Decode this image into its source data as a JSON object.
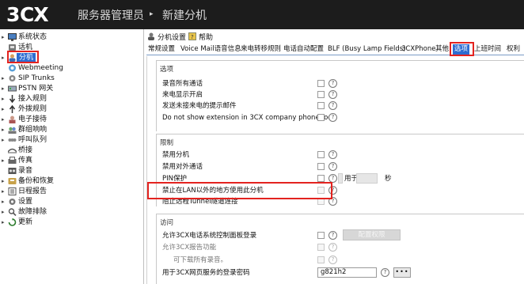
{
  "header": {
    "logo_text": "3CX",
    "title": "服务器管理员",
    "arrow": "▸",
    "page": "新建分机"
  },
  "sidebar": {
    "items": [
      {
        "label": "系统状态",
        "icon": "monitor-icon",
        "expandable": true
      },
      {
        "label": "话机",
        "icon": "phone-icon",
        "expandable": false
      },
      {
        "label": "分机",
        "icon": "user-icon",
        "expandable": true,
        "selected": true
      },
      {
        "label": "Webmeeting",
        "icon": "webmeeting-icon",
        "expandable": false
      },
      {
        "label": "SIP Trunks",
        "icon": "gear-icon",
        "expandable": true
      },
      {
        "label": "PSTN 网关",
        "icon": "gateway-icon",
        "expandable": true
      },
      {
        "label": "接入规则",
        "icon": "inbound-arrow-icon",
        "expandable": true
      },
      {
        "label": "外拨规则",
        "icon": "outbound-arrow-icon",
        "expandable": true
      },
      {
        "label": "电子接待",
        "icon": "receptionist-icon",
        "expandable": true
      },
      {
        "label": "群组响响",
        "icon": "ring-group-icon",
        "expandable": true
      },
      {
        "label": "呼叫队列",
        "icon": "queue-icon",
        "expandable": true
      },
      {
        "label": "桥接",
        "icon": "bridge-icon",
        "expandable": false
      },
      {
        "label": "传真",
        "icon": "fax-icon",
        "expandable": true
      },
      {
        "label": "录音",
        "icon": "recording-icon",
        "expandable": false
      },
      {
        "label": "备份和恢复",
        "icon": "backup-icon",
        "expandable": true
      },
      {
        "label": "日程报告",
        "icon": "report-icon",
        "expandable": true
      },
      {
        "label": "设置",
        "icon": "settings-icon",
        "expandable": true
      },
      {
        "label": "故障排除",
        "icon": "troubleshoot-icon",
        "expandable": true
      },
      {
        "label": "更新",
        "icon": "update-icon",
        "expandable": true
      }
    ]
  },
  "toolbar": {
    "settings_label": "分机设置",
    "help_label": "帮助"
  },
  "tabs": [
    {
      "label": "常规设置"
    },
    {
      "label": "Voice Mail语音信息"
    },
    {
      "label": "来电转移规则"
    },
    {
      "label": "电话自动配置"
    },
    {
      "label": "BLF (Busy Lamp Fields)"
    },
    {
      "label": "3CXPhone"
    },
    {
      "label": "其他"
    },
    {
      "label": "选项",
      "active": true
    },
    {
      "label": "上班时间"
    },
    {
      "label": "权利"
    }
  ],
  "options": {
    "title": "选项",
    "rows": [
      {
        "label": "录音所有通话"
      },
      {
        "label": "来电显示开启"
      },
      {
        "label": "发送未接来电的提示邮件"
      },
      {
        "label": "Do not show extension in 3CX company phonebook"
      }
    ]
  },
  "restrictions": {
    "title": "限制",
    "rows": [
      {
        "label": "禁用分机"
      },
      {
        "label": "禁用对外通话"
      },
      {
        "label": "PIN保护"
      },
      {
        "label": "禁止在LAN以外的地方使用此分机"
      },
      {
        "label": "阻止远程Tunnel隧道连接"
      }
    ],
    "pin_for_label": "用于",
    "pin_seconds_label": "秒"
  },
  "access": {
    "title": "访问",
    "rows": [
      {
        "label": "允许3CX电话系统控制面板登录"
      },
      {
        "label": "允许3CX报告功能"
      },
      {
        "label": "可下载所有录音。"
      },
      {
        "label": "用于3CX网页服务的登录密码"
      }
    ],
    "config_rights_button": "配置权限",
    "password_value": "g821h2",
    "dots_button": "•••"
  },
  "help_glyph": "?",
  "colors": {
    "header_bg": "#1c1c1c",
    "selected_bg": "#2d6cd1",
    "highlight_box": "#e3231f"
  }
}
